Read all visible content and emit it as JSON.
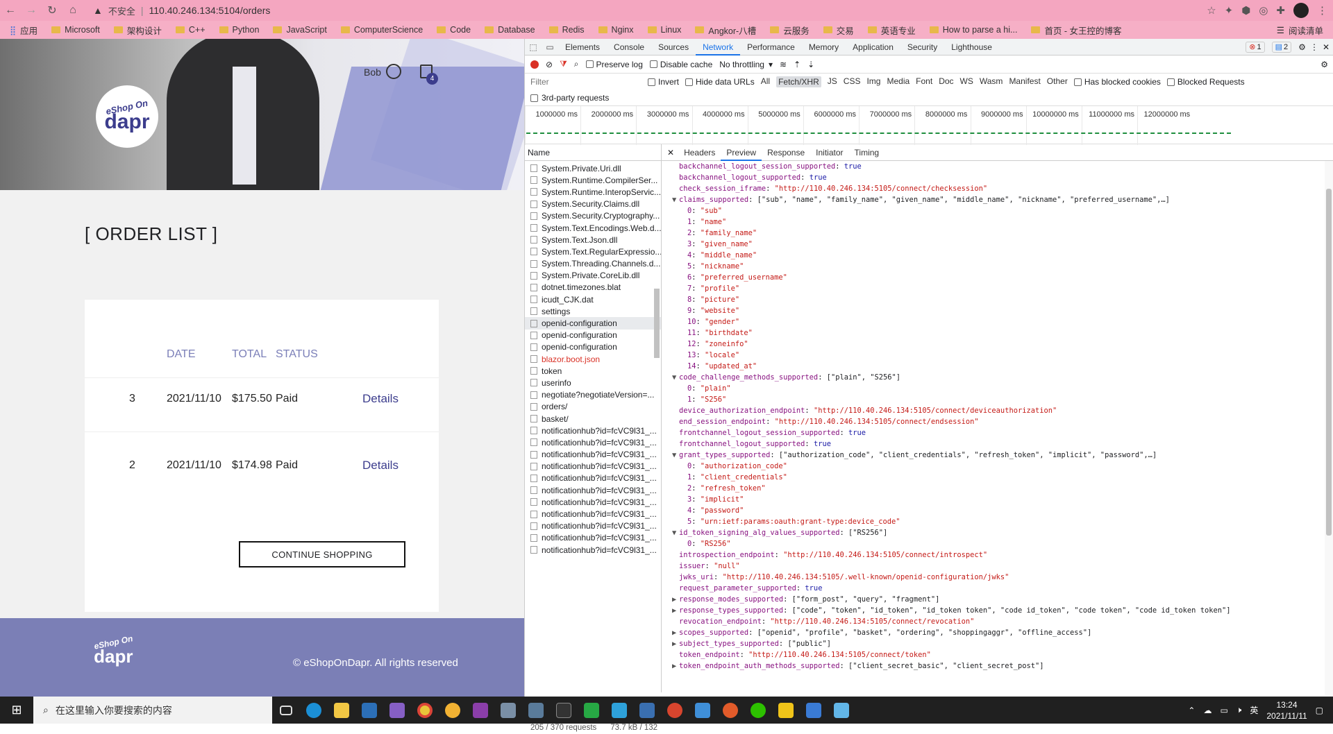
{
  "browser": {
    "security_text": "不安全",
    "url": "110.40.246.134:5104/orders",
    "bookmarks": [
      "应用",
      "Microsoft",
      "架构设计",
      "C++",
      "Python",
      "JavaScript",
      "ComputerScience",
      "Code",
      "Database",
      "Redis",
      "Nginx",
      "Linux",
      "Angkor-八槽",
      "云服务",
      "交易",
      "英语专业",
      "How to parse a hi...",
      "首页 - 女王控的博客"
    ],
    "reading_list": "阅读清单"
  },
  "site": {
    "logo_small": "eShop On",
    "logo_big": "dapr",
    "user_name": "Bob",
    "cart_count": "4",
    "order_title": "[ ORDER LIST ]",
    "columns": [
      "DATE",
      "TOTAL",
      "STATUS"
    ],
    "orders": [
      {
        "number": "3",
        "date": "2021/11/10",
        "total": "$175.50",
        "status": "Paid",
        "action": "Details"
      },
      {
        "number": "2",
        "date": "2021/11/10",
        "total": "$174.98",
        "status": "Paid",
        "action": "Details"
      }
    ],
    "continue_label": "CONTINUE SHOPPING",
    "footer_copyright": "© eShopOnDapr. All rights reserved"
  },
  "devtools": {
    "tabs": [
      "Elements",
      "Console",
      "Sources",
      "Network",
      "Performance",
      "Memory",
      "Application",
      "Security",
      "Lighthouse"
    ],
    "active_tab": "Network",
    "error_count": "1",
    "message_count": "2",
    "toolbar": {
      "preserve_log": "Preserve log",
      "disable_cache": "Disable cache",
      "throttling": "No throttling"
    },
    "filter": {
      "placeholder": "Filter",
      "invert": "Invert",
      "hide_data_urls": "Hide data URLs",
      "types": [
        "All",
        "Fetch/XHR",
        "JS",
        "CSS",
        "Img",
        "Media",
        "Font",
        "Doc",
        "WS",
        "Wasm",
        "Manifest",
        "Other"
      ],
      "active_type": "Fetch/XHR",
      "has_blocked_cookies": "Has blocked cookies",
      "blocked_requests": "Blocked Requests",
      "third_party": "3rd-party requests"
    },
    "timeline_ticks": [
      "1000000 ms",
      "2000000 ms",
      "3000000 ms",
      "4000000 ms",
      "5000000 ms",
      "6000000 ms",
      "7000000 ms",
      "8000000 ms",
      "9000000 ms",
      "10000000 ms",
      "11000000 ms",
      "12000000 ms"
    ],
    "name_header": "Name",
    "requests": [
      {
        "name": "System.Private.Uri.dll"
      },
      {
        "name": "System.Runtime.CompilerSer..."
      },
      {
        "name": "System.Runtime.InteropServic..."
      },
      {
        "name": "System.Security.Claims.dll"
      },
      {
        "name": "System.Security.Cryptography..."
      },
      {
        "name": "System.Text.Encodings.Web.d..."
      },
      {
        "name": "System.Text.Json.dll"
      },
      {
        "name": "System.Text.RegularExpressio..."
      },
      {
        "name": "System.Threading.Channels.d..."
      },
      {
        "name": "System.Private.CoreLib.dll"
      },
      {
        "name": "dotnet.timezones.blat"
      },
      {
        "name": "icudt_CJK.dat"
      },
      {
        "name": "settings"
      },
      {
        "name": "openid-configuration",
        "selected": true
      },
      {
        "name": "openid-configuration"
      },
      {
        "name": "openid-configuration"
      },
      {
        "name": "blazor.boot.json",
        "error": true
      },
      {
        "name": "token"
      },
      {
        "name": "userinfo"
      },
      {
        "name": "negotiate?negotiateVersion=..."
      },
      {
        "name": "orders/"
      },
      {
        "name": "basket/"
      },
      {
        "name": "notificationhub?id=fcVC9l31_..."
      },
      {
        "name": "notificationhub?id=fcVC9l31_..."
      },
      {
        "name": "notificationhub?id=fcVC9l31_..."
      },
      {
        "name": "notificationhub?id=fcVC9l31_..."
      },
      {
        "name": "notificationhub?id=fcVC9l31_..."
      },
      {
        "name": "notificationhub?id=fcVC9l31_..."
      },
      {
        "name": "notificationhub?id=fcVC9l31_..."
      },
      {
        "name": "notificationhub?id=fcVC9l31_..."
      },
      {
        "name": "notificationhub?id=fcVC9l31_..."
      },
      {
        "name": "notificationhub?id=fcVC9l31_..."
      },
      {
        "name": "notificationhub?id=fcVC9l31_..."
      }
    ],
    "requests_count": "205 / 370 requests",
    "transfer_size": "73.7 kB / 132",
    "detail_tabs": [
      "Headers",
      "Preview",
      "Response",
      "Initiator",
      "Timing"
    ],
    "active_detail_tab": "Preview",
    "preview_lines": [
      {
        "arrow": "",
        "indent": 0,
        "key": "backchannel_logout_session_supported",
        "value": "true",
        "vtype": "b"
      },
      {
        "arrow": "",
        "indent": 0,
        "key": "backchannel_logout_supported",
        "value": "true",
        "vtype": "b"
      },
      {
        "arrow": "",
        "indent": 0,
        "key": "check_session_iframe",
        "value": "\"http://110.40.246.134:5105/connect/checksession\"",
        "vtype": "s"
      },
      {
        "arrow": "▼",
        "indent": 0,
        "key": "claims_supported",
        "value": "[\"sub\", \"name\", \"family_name\", \"given_name\", \"middle_name\", \"nickname\", \"preferred_username\",…]",
        "vtype": "p"
      },
      {
        "arrow": "",
        "indent": 1,
        "key": "0",
        "value": "\"sub\"",
        "vtype": "s"
      },
      {
        "arrow": "",
        "indent": 1,
        "key": "1",
        "value": "\"name\"",
        "vtype": "s"
      },
      {
        "arrow": "",
        "indent": 1,
        "key": "2",
        "value": "\"family_name\"",
        "vtype": "s"
      },
      {
        "arrow": "",
        "indent": 1,
        "key": "3",
        "value": "\"given_name\"",
        "vtype": "s"
      },
      {
        "arrow": "",
        "indent": 1,
        "key": "4",
        "value": "\"middle_name\"",
        "vtype": "s"
      },
      {
        "arrow": "",
        "indent": 1,
        "key": "5",
        "value": "\"nickname\"",
        "vtype": "s"
      },
      {
        "arrow": "",
        "indent": 1,
        "key": "6",
        "value": "\"preferred_username\"",
        "vtype": "s"
      },
      {
        "arrow": "",
        "indent": 1,
        "key": "7",
        "value": "\"profile\"",
        "vtype": "s"
      },
      {
        "arrow": "",
        "indent": 1,
        "key": "8",
        "value": "\"picture\"",
        "vtype": "s"
      },
      {
        "arrow": "",
        "indent": 1,
        "key": "9",
        "value": "\"website\"",
        "vtype": "s"
      },
      {
        "arrow": "",
        "indent": 1,
        "key": "10",
        "value": "\"gender\"",
        "vtype": "s"
      },
      {
        "arrow": "",
        "indent": 1,
        "key": "11",
        "value": "\"birthdate\"",
        "vtype": "s"
      },
      {
        "arrow": "",
        "indent": 1,
        "key": "12",
        "value": "\"zoneinfo\"",
        "vtype": "s"
      },
      {
        "arrow": "",
        "indent": 1,
        "key": "13",
        "value": "\"locale\"",
        "vtype": "s"
      },
      {
        "arrow": "",
        "indent": 1,
        "key": "14",
        "value": "\"updated_at\"",
        "vtype": "s"
      },
      {
        "arrow": "▼",
        "indent": 0,
        "key": "code_challenge_methods_supported",
        "value": "[\"plain\", \"S256\"]",
        "vtype": "p"
      },
      {
        "arrow": "",
        "indent": 1,
        "key": "0",
        "value": "\"plain\"",
        "vtype": "s"
      },
      {
        "arrow": "",
        "indent": 1,
        "key": "1",
        "value": "\"S256\"",
        "vtype": "s"
      },
      {
        "arrow": "",
        "indent": 0,
        "key": "device_authorization_endpoint",
        "value": "\"http://110.40.246.134:5105/connect/deviceauthorization\"",
        "vtype": "s"
      },
      {
        "arrow": "",
        "indent": 0,
        "key": "end_session_endpoint",
        "value": "\"http://110.40.246.134:5105/connect/endsession\"",
        "vtype": "s"
      },
      {
        "arrow": "",
        "indent": 0,
        "key": "frontchannel_logout_session_supported",
        "value": "true",
        "vtype": "b"
      },
      {
        "arrow": "",
        "indent": 0,
        "key": "frontchannel_logout_supported",
        "value": "true",
        "vtype": "b"
      },
      {
        "arrow": "▼",
        "indent": 0,
        "key": "grant_types_supported",
        "value": "[\"authorization_code\", \"client_credentials\", \"refresh_token\", \"implicit\", \"password\",…]",
        "vtype": "p"
      },
      {
        "arrow": "",
        "indent": 1,
        "key": "0",
        "value": "\"authorization_code\"",
        "vtype": "s"
      },
      {
        "arrow": "",
        "indent": 1,
        "key": "1",
        "value": "\"client_credentials\"",
        "vtype": "s"
      },
      {
        "arrow": "",
        "indent": 1,
        "key": "2",
        "value": "\"refresh_token\"",
        "vtype": "s"
      },
      {
        "arrow": "",
        "indent": 1,
        "key": "3",
        "value": "\"implicit\"",
        "vtype": "s"
      },
      {
        "arrow": "",
        "indent": 1,
        "key": "4",
        "value": "\"password\"",
        "vtype": "s"
      },
      {
        "arrow": "",
        "indent": 1,
        "key": "5",
        "value": "\"urn:ietf:params:oauth:grant-type:device_code\"",
        "vtype": "s"
      },
      {
        "arrow": "▼",
        "indent": 0,
        "key": "id_token_signing_alg_values_supported",
        "value": "[\"RS256\"]",
        "vtype": "p"
      },
      {
        "arrow": "",
        "indent": 1,
        "key": "0",
        "value": "\"RS256\"",
        "vtype": "s"
      },
      {
        "arrow": "",
        "indent": 0,
        "key": "introspection_endpoint",
        "value": "\"http://110.40.246.134:5105/connect/introspect\"",
        "vtype": "s"
      },
      {
        "arrow": "",
        "indent": 0,
        "key": "issuer",
        "value": "\"null\"",
        "vtype": "s"
      },
      {
        "arrow": "",
        "indent": 0,
        "key": "jwks_uri",
        "value": "\"http://110.40.246.134:5105/.well-known/openid-configuration/jwks\"",
        "vtype": "s"
      },
      {
        "arrow": "",
        "indent": 0,
        "key": "request_parameter_supported",
        "value": "true",
        "vtype": "b"
      },
      {
        "arrow": "▶",
        "indent": 0,
        "key": "response_modes_supported",
        "value": "[\"form_post\", \"query\", \"fragment\"]",
        "vtype": "p"
      },
      {
        "arrow": "▶",
        "indent": 0,
        "key": "response_types_supported",
        "value": "[\"code\", \"token\", \"id_token\", \"id_token token\", \"code id_token\", \"code token\", \"code id_token token\"]",
        "vtype": "p"
      },
      {
        "arrow": "",
        "indent": 0,
        "key": "revocation_endpoint",
        "value": "\"http://110.40.246.134:5105/connect/revocation\"",
        "vtype": "s"
      },
      {
        "arrow": "▶",
        "indent": 0,
        "key": "scopes_supported",
        "value": "[\"openid\", \"profile\", \"basket\", \"ordering\", \"shoppingaggr\", \"offline_access\"]",
        "vtype": "p"
      },
      {
        "arrow": "▶",
        "indent": 0,
        "key": "subject_types_supported",
        "value": "[\"public\"]",
        "vtype": "p"
      },
      {
        "arrow": "",
        "indent": 0,
        "key": "token_endpoint",
        "value": "\"http://110.40.246.134:5105/connect/token\"",
        "vtype": "s"
      },
      {
        "arrow": "▶",
        "indent": 0,
        "key": "token_endpoint_auth_methods_supported",
        "value": "[\"client_secret_basic\", \"client_secret_post\"]",
        "vtype": "p"
      }
    ]
  },
  "taskbar": {
    "search_placeholder": "在这里输入你要搜索的内容",
    "ime": "英",
    "time": "13:24",
    "date": "2021/11/11"
  },
  "colors": {
    "accent": "#3c3d8d",
    "footer": "#7b7fb6",
    "chrome": "#f4a6c0"
  }
}
